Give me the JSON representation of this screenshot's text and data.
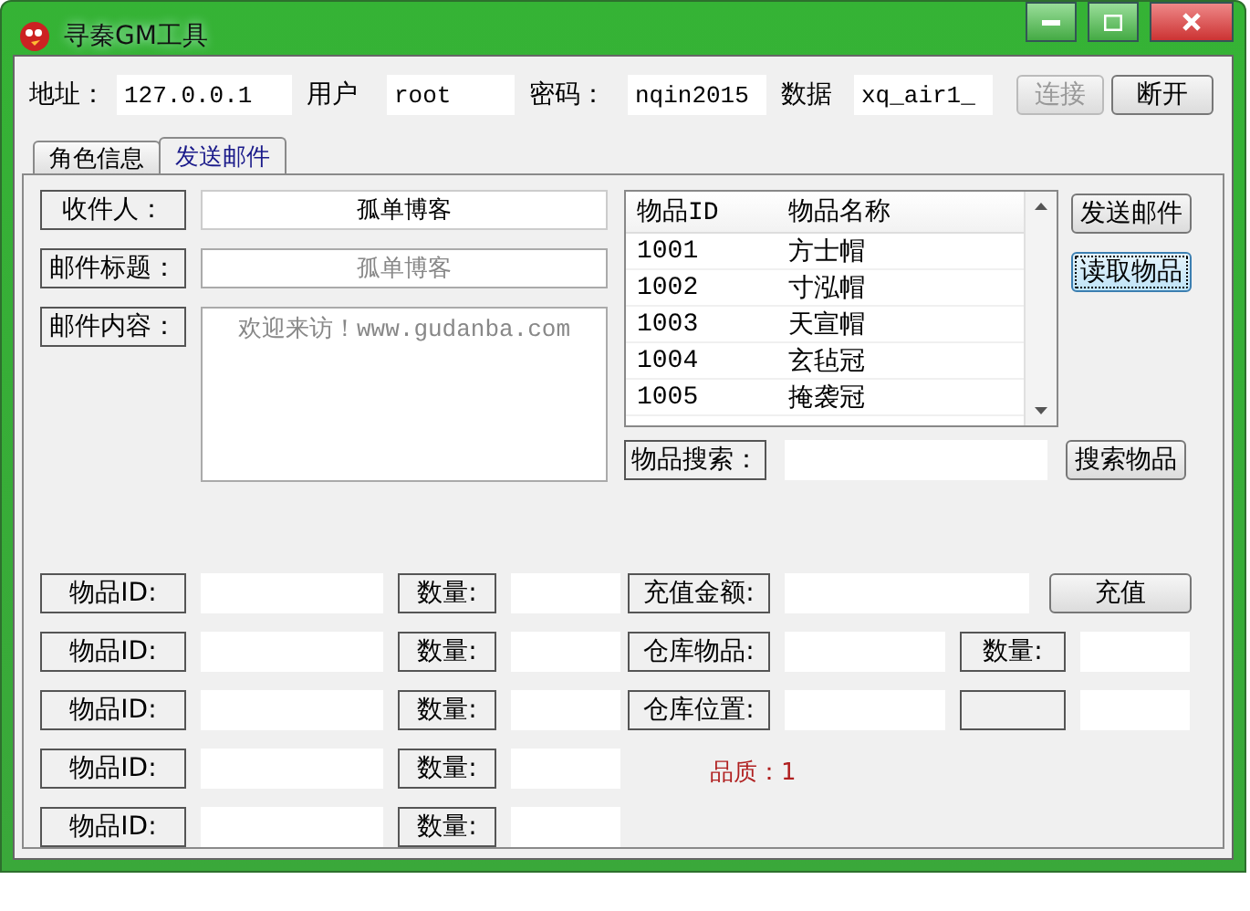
{
  "window": {
    "title": "寻秦GM工具"
  },
  "connection": {
    "fields": [
      {
        "label": "地址：",
        "value": "127.0.0.1"
      },
      {
        "label": "用户",
        "value": "root"
      },
      {
        "label": "密码：",
        "value": "nqin2015"
      },
      {
        "label": "数据",
        "value": "xq_air1_"
      }
    ],
    "buttons": [
      {
        "label": "连接",
        "disabled": true
      },
      {
        "label": "断开",
        "disabled": false
      }
    ]
  },
  "tabs": [
    {
      "label": "角色信息",
      "selected": false
    },
    {
      "label": "发送邮件",
      "selected": true
    }
  ],
  "mail": {
    "recipient": {
      "label": "收件人：",
      "value": "孤单博客"
    },
    "subject": {
      "label": "邮件标题：",
      "placeholder": "孤单博客"
    },
    "content": {
      "label": "邮件内容：",
      "placeholder": "欢迎来访！www.gudanba.com"
    }
  },
  "item_list": {
    "columns": [
      "物品ID",
      "物品名称"
    ],
    "rows": [
      [
        "1001",
        "方士帽"
      ],
      [
        "1002",
        "寸泓帽"
      ],
      [
        "1003",
        "天宣帽"
      ],
      [
        "1004",
        "玄毡冠"
      ],
      [
        "1005",
        "掩袭冠"
      ]
    ]
  },
  "side_buttons": [
    {
      "label": "发送邮件",
      "focused": false
    },
    {
      "label": "读取物品",
      "focused": true
    }
  ],
  "search": {
    "label": "物品搜索：",
    "button": "搜索物品"
  },
  "item_rows": [
    {
      "id_label": "物品ID:",
      "count_label": "数量:"
    },
    {
      "id_label": "物品ID:",
      "count_label": "数量:"
    },
    {
      "id_label": "物品ID:",
      "count_label": "数量:"
    },
    {
      "id_label": "物品ID:",
      "count_label": "数量:"
    },
    {
      "id_label": "物品ID:",
      "count_label": "数量:"
    }
  ],
  "recharge": {
    "label": "充值金额:",
    "button": "充值"
  },
  "warehouse": [
    {
      "label": "仓库物品:",
      "count_label": "数量:"
    },
    {
      "label": "仓库位置:"
    }
  ],
  "quality": "品质：1"
}
